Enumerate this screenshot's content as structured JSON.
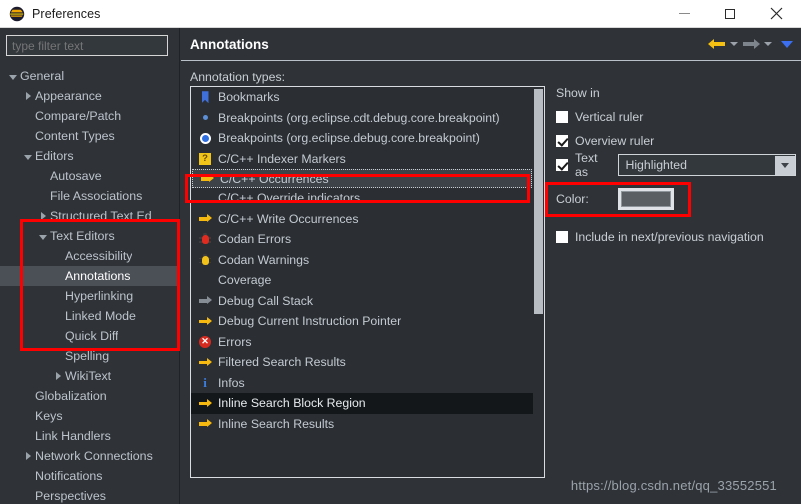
{
  "window": {
    "title": "Preferences",
    "icon": "eclipse-icon",
    "controls": {
      "minimize": "minimize-icon",
      "maximize": "maximize-icon",
      "close": "close-icon"
    }
  },
  "sidebar": {
    "filter": {
      "placeholder": "type filter text",
      "value": ""
    },
    "tree": [
      {
        "label": "General",
        "indent": 0,
        "twisty": "down",
        "selected": false
      },
      {
        "label": "Appearance",
        "indent": 1,
        "twisty": "right",
        "selected": false
      },
      {
        "label": "Compare/Patch",
        "indent": 1,
        "twisty": "none",
        "selected": false
      },
      {
        "label": "Content Types",
        "indent": 1,
        "twisty": "none",
        "selected": false
      },
      {
        "label": "Editors",
        "indent": 1,
        "twisty": "down",
        "selected": false
      },
      {
        "label": "Autosave",
        "indent": 2,
        "twisty": "none",
        "selected": false
      },
      {
        "label": "File Associations",
        "indent": 2,
        "twisty": "none",
        "selected": false
      },
      {
        "label": "Structured Text Ed",
        "indent": 2,
        "twisty": "right",
        "selected": false
      },
      {
        "label": "Text Editors",
        "indent": 2,
        "twisty": "down",
        "selected": false
      },
      {
        "label": "Accessibility",
        "indent": 3,
        "twisty": "none",
        "selected": false
      },
      {
        "label": "Annotations",
        "indent": 3,
        "twisty": "none",
        "selected": true
      },
      {
        "label": "Hyperlinking",
        "indent": 3,
        "twisty": "none",
        "selected": false
      },
      {
        "label": "Linked Mode",
        "indent": 3,
        "twisty": "none",
        "selected": false
      },
      {
        "label": "Quick Diff",
        "indent": 3,
        "twisty": "none",
        "selected": false
      },
      {
        "label": "Spelling",
        "indent": 3,
        "twisty": "none",
        "selected": false
      },
      {
        "label": "WikiText",
        "indent": 3,
        "twisty": "right",
        "selected": false
      },
      {
        "label": "Globalization",
        "indent": 1,
        "twisty": "none",
        "selected": false
      },
      {
        "label": "Keys",
        "indent": 1,
        "twisty": "none",
        "selected": false
      },
      {
        "label": "Link Handlers",
        "indent": 1,
        "twisty": "none",
        "selected": false
      },
      {
        "label": "Network Connections",
        "indent": 1,
        "twisty": "right",
        "selected": false
      },
      {
        "label": "Notifications",
        "indent": 1,
        "twisty": "none",
        "selected": false
      },
      {
        "label": "Perspectives",
        "indent": 1,
        "twisty": "none",
        "selected": false
      }
    ]
  },
  "main": {
    "title": "Annotations",
    "nav": {
      "back": "back-arrow-icon",
      "back_menu": "chevron-down-icon",
      "forward": "forward-arrow-icon",
      "forward_menu": "chevron-down-icon",
      "view_menu": "chevron-down-blue-icon"
    },
    "list_label": "Annotation types:",
    "annotation_types": [
      {
        "label": "Bookmarks",
        "icon": "bookmark-icon",
        "state": "normal"
      },
      {
        "label": "Breakpoints (org.eclipse.cdt.debug.core.breakpoint)",
        "icon": "small-dot-icon",
        "state": "normal"
      },
      {
        "label": "Breakpoints (org.eclipse.debug.core.breakpoint)",
        "icon": "breakpoint-circle-icon",
        "state": "normal"
      },
      {
        "label": "C/C++ Indexer Markers",
        "icon": "question-marker-icon",
        "state": "normal"
      },
      {
        "label": "C/C++ Occurrences",
        "icon": "arrow-yellow-icon",
        "state": "focused"
      },
      {
        "label": "C/C++ Override indicators",
        "icon": "none",
        "state": "normal"
      },
      {
        "label": "C/C++ Write Occurrences",
        "icon": "arrow-yellow-icon",
        "state": "normal"
      },
      {
        "label": "Codan Errors",
        "icon": "bug-red-icon",
        "state": "normal"
      },
      {
        "label": "Codan Warnings",
        "icon": "bug-yellow-icon",
        "state": "normal"
      },
      {
        "label": "Coverage",
        "icon": "none",
        "state": "normal"
      },
      {
        "label": "Debug Call Stack",
        "icon": "arrow-gray-icon",
        "state": "normal"
      },
      {
        "label": "Debug Current Instruction Pointer",
        "icon": "arrow-yellow-icon",
        "state": "normal"
      },
      {
        "label": "Errors",
        "icon": "error-icon",
        "state": "normal"
      },
      {
        "label": "Filtered Search Results",
        "icon": "arrow-yellow-icon",
        "state": "normal"
      },
      {
        "label": "Infos",
        "icon": "info-icon",
        "state": "normal"
      },
      {
        "label": "Inline Search Block Region",
        "icon": "arrow-yellow-icon",
        "state": "highlighted"
      },
      {
        "label": "Inline Search Results",
        "icon": "arrow-yellow-icon",
        "state": "normal"
      }
    ],
    "options": {
      "show_in_label": "Show in",
      "vertical_ruler": {
        "label": "Vertical ruler",
        "checked": false
      },
      "overview_ruler": {
        "label": "Overview ruler",
        "checked": true
      },
      "text_as": {
        "label": "Text as",
        "checked": true,
        "value": "Highlighted"
      },
      "color": {
        "label": "Color:",
        "swatch": "#5a5f63"
      },
      "include_nav": {
        "label": "Include in next/previous navigation",
        "checked": false
      }
    }
  },
  "watermark": "https://blog.csdn.net/qq_33552551",
  "colors": {
    "accent_yellow": "#f5b90f",
    "accent_blue": "#3b6ff0",
    "highlight_red": "#ff0000",
    "selection": "#4b5056",
    "background": "#2f3338"
  }
}
